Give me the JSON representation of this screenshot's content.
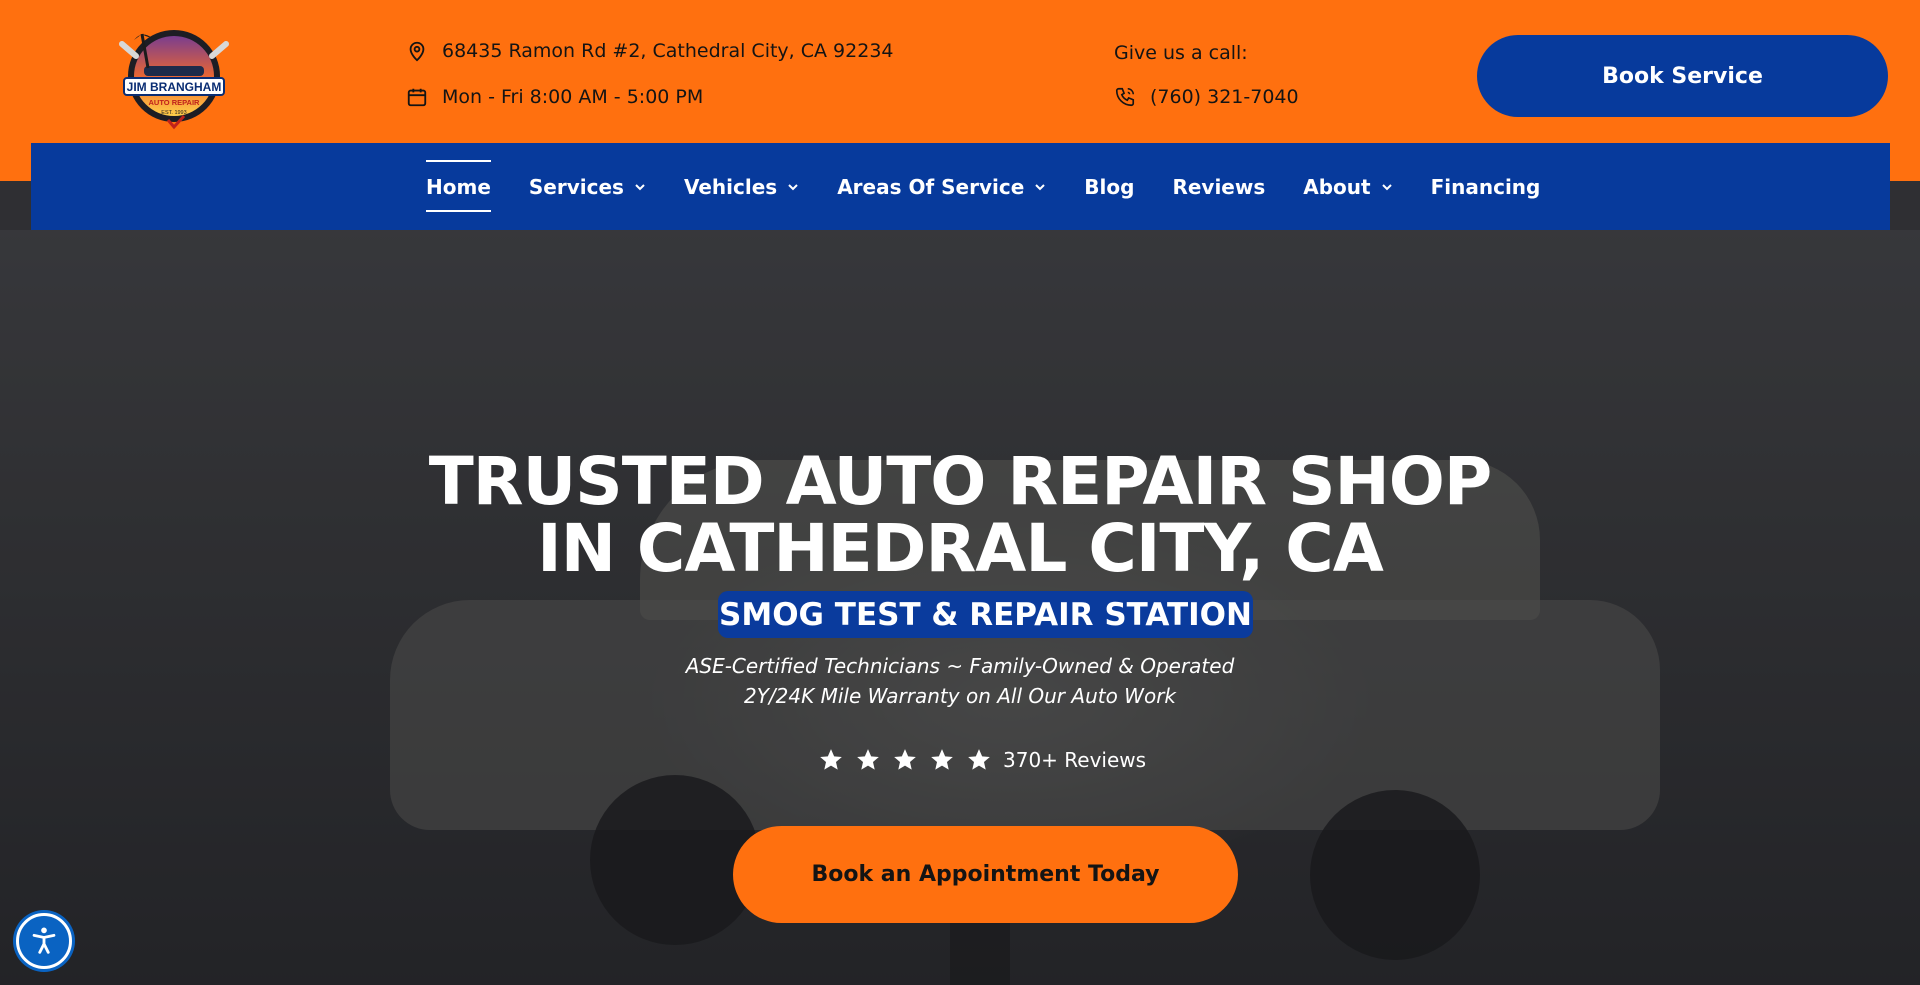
{
  "header": {
    "logo_text": "JIM BRANGHAM",
    "logo_sub": "AUTO REPAIR",
    "logo_est": "EST. 1993",
    "address": "68435 Ramon Rd #2, Cathedral City, CA 92234",
    "hours": "Mon - Fri 8:00 AM - 5:00 PM",
    "call_label": "Give us a call:",
    "phone": "(760) 321-7040",
    "cta": "Book Service"
  },
  "nav": {
    "items": [
      {
        "label": "Home",
        "dropdown": false,
        "active": true
      },
      {
        "label": "Services",
        "dropdown": true
      },
      {
        "label": "Vehicles",
        "dropdown": true
      },
      {
        "label": "Areas Of Service",
        "dropdown": true
      },
      {
        "label": "Blog",
        "dropdown": false
      },
      {
        "label": "Reviews",
        "dropdown": false
      },
      {
        "label": "About",
        "dropdown": true
      },
      {
        "label": "Financing",
        "dropdown": false
      }
    ]
  },
  "hero": {
    "title_line1": "TRUSTED AUTO REPAIR SHOP",
    "title_line2": "IN CATHEDRAL CITY, CA",
    "badge": "SMOG TEST & REPAIR STATION",
    "subtitle_line1": "ASE-Certified Technicians ~ Family-Owned & Operated",
    "subtitle_line2": "2Y/24K Mile Warranty on All Our Auto Work",
    "rating_stars": 5,
    "reviews_text": "370+ Reviews",
    "cta": "Book an Appointment Today"
  },
  "colors": {
    "orange": "#ff700f",
    "blue": "#073a9c",
    "white": "#ffffff"
  },
  "icons": {
    "address": "map-pin-icon",
    "hours": "calendar-icon",
    "phone": "phone-icon",
    "dropdown": "chevron-down-icon",
    "star": "star-icon",
    "accessibility": "accessibility-icon"
  }
}
